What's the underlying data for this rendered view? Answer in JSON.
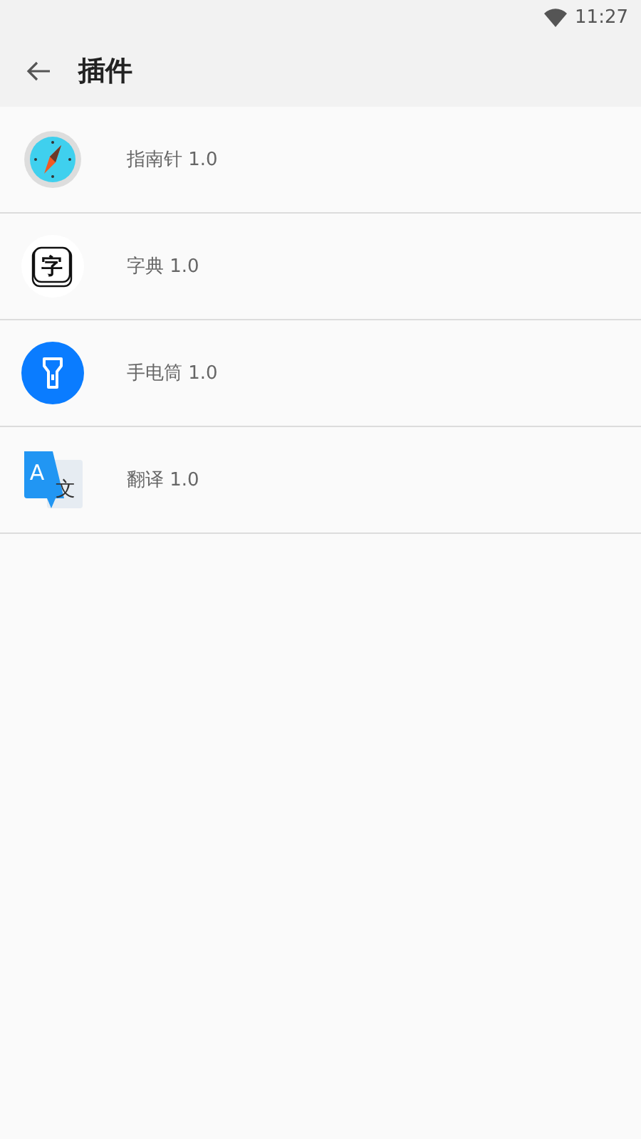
{
  "status_bar": {
    "time": "11:27"
  },
  "app_bar": {
    "title": "插件"
  },
  "plugins": [
    {
      "kind": "compass",
      "label": "指南针 1.0"
    },
    {
      "kind": "dictionary",
      "label": "字典 1.0",
      "icon_text": "字"
    },
    {
      "kind": "flashlight",
      "label": "手电筒 1.0"
    },
    {
      "kind": "translate",
      "label": "翻译 1.0",
      "icon_text": "A",
      "icon_text_2": "文"
    }
  ]
}
